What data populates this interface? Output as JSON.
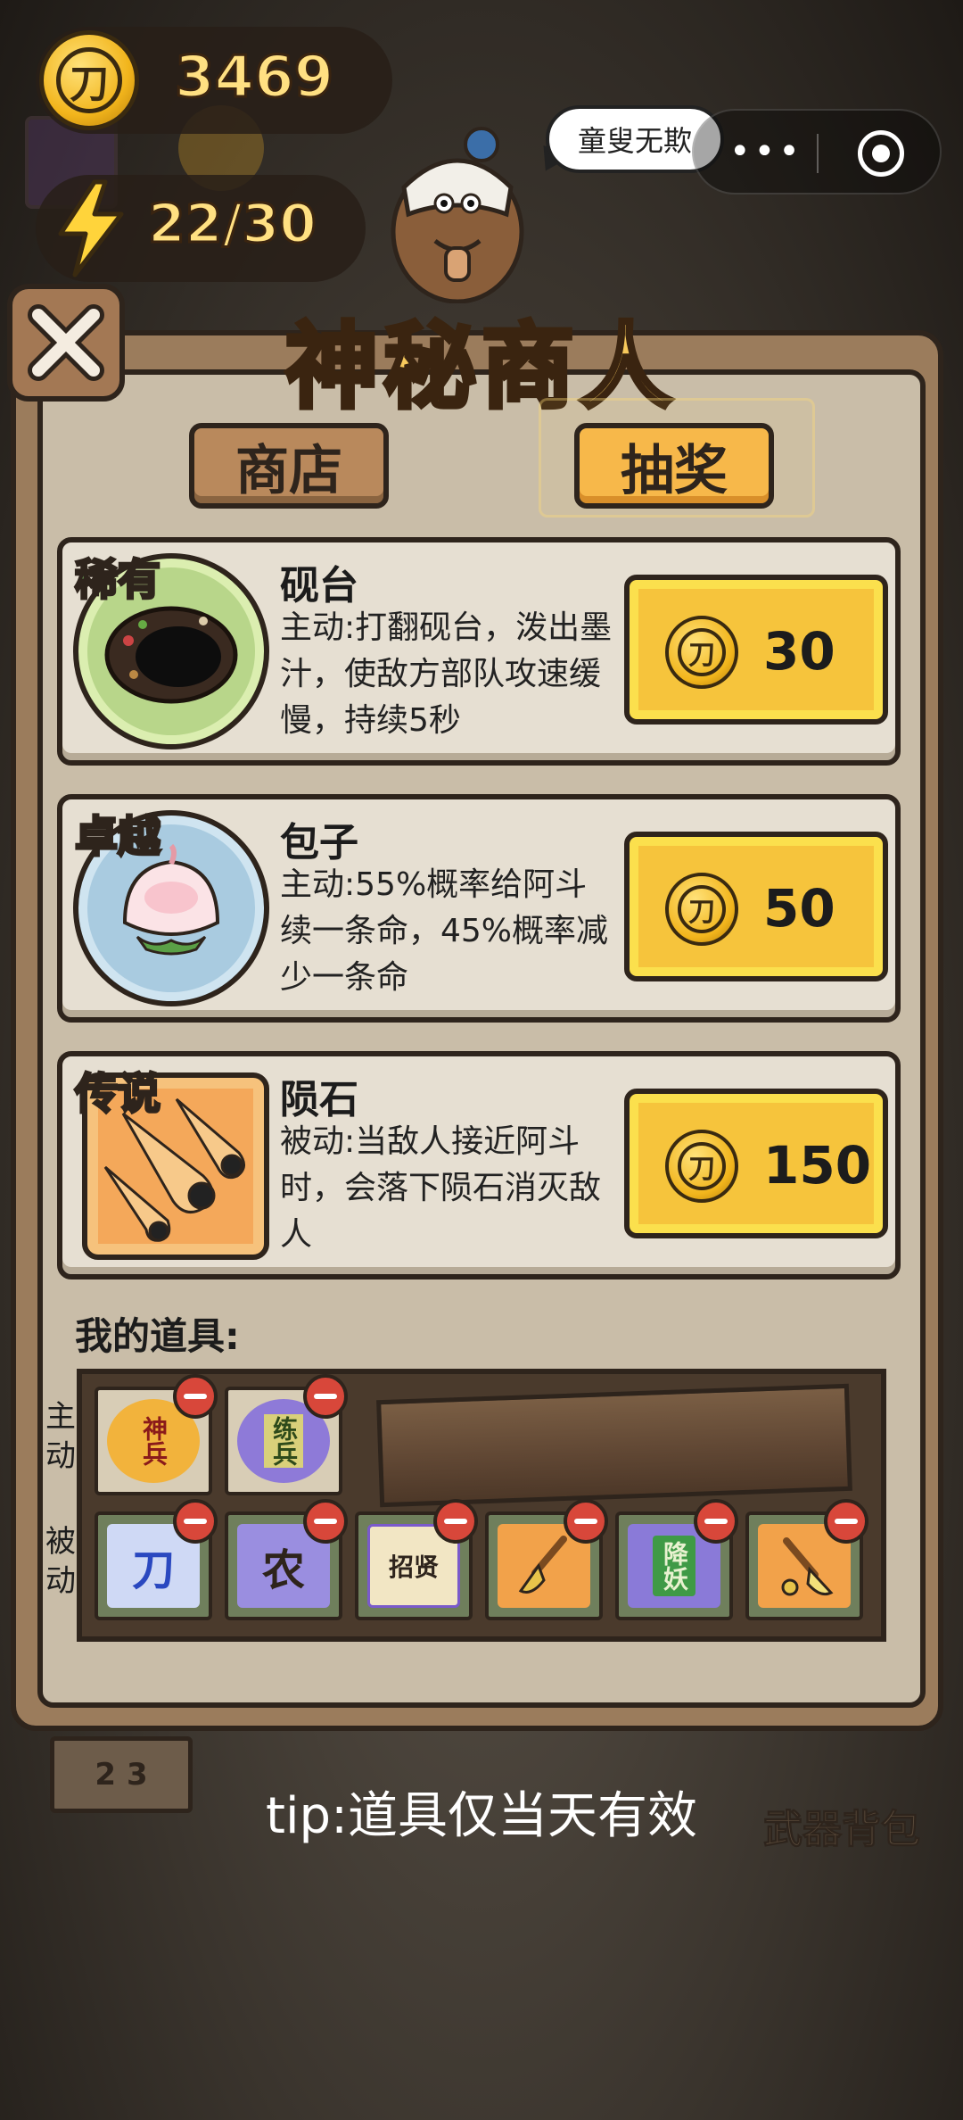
{
  "hud": {
    "coin_value": "3469",
    "energy_value": "22/30",
    "coin_symbol": "刀"
  },
  "speech_bubble": "童叟无欺",
  "title": "神秘商人",
  "tabs": [
    {
      "label": "商店",
      "selected": false
    },
    {
      "label": "抽奖",
      "selected": true
    }
  ],
  "items": [
    {
      "rarity": "稀有",
      "rarity_color": "#8fe07a",
      "name": "砚台",
      "description": "主动:打翻砚台，泼出墨汁，使敌方部队攻速缓慢，持续5秒",
      "price": "30",
      "icon": "inkstone-icon"
    },
    {
      "rarity": "卓越",
      "rarity_color": "#7ec7ff",
      "name": "包子",
      "description": "主动:55%概率给阿斗续一条命，45%概率减少一条命",
      "price": "50",
      "icon": "bun-icon"
    },
    {
      "rarity": "传说",
      "rarity_color": "#ffb04a",
      "name": "陨石",
      "description": "被动:当敌人接近阿斗时，会落下陨石消灭敌人",
      "price": "150",
      "icon": "meteor-icon"
    }
  ],
  "inventory": {
    "label": "我的道具:",
    "active_label": "主动",
    "passive_label": "被动",
    "active_items": [
      {
        "text": "神兵",
        "icon": "divine-weapon-icon"
      },
      {
        "text": "练兵",
        "icon": "drill-troops-icon"
      }
    ],
    "passive_items": [
      {
        "text": "刀",
        "icon": "blade-card-icon"
      },
      {
        "text": "农",
        "icon": "farm-card-icon"
      },
      {
        "text": "招贤",
        "icon": "recruit-scroll-icon"
      },
      {
        "text": "",
        "icon": "shovel-icon"
      },
      {
        "text": "降妖",
        "icon": "demon-talisman-icon"
      },
      {
        "text": "",
        "icon": "dig-shovel-icon"
      }
    ]
  },
  "tip": "tip:道具仅当天有效",
  "weapon_backpack": "武器背包",
  "bottom_sign": [
    "2",
    "3"
  ],
  "colors": {
    "title": "#f7c95c",
    "price_button": "#f6c43c",
    "panel": "#c9bda8",
    "card": "#e6dfd2",
    "minus": "#d8473a"
  }
}
